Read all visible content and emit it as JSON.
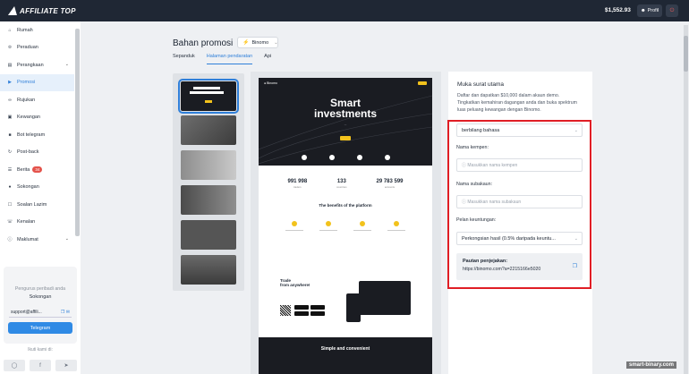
{
  "header": {
    "logo": "AFFILIATE TOP",
    "balance": "$1,552.93",
    "profile_label": "Profil",
    "logout_icon": "logout-icon"
  },
  "sidebar": {
    "items": [
      {
        "label": "Rumah",
        "icon": "home-icon"
      },
      {
        "label": "Peraduan",
        "icon": "trophy-icon"
      },
      {
        "label": "Perangkaan",
        "icon": "chart-icon"
      },
      {
        "label": "Promosi",
        "icon": "megaphone-icon"
      },
      {
        "label": "Rujukan",
        "icon": "link-icon"
      },
      {
        "label": "Kewangan",
        "icon": "wallet-icon"
      },
      {
        "label": "Bot telegram",
        "icon": "bot-icon"
      },
      {
        "label": "Post-back",
        "icon": "postback-icon"
      },
      {
        "label": "Berita",
        "icon": "news-icon",
        "badge": "34"
      },
      {
        "label": "Sokongan",
        "icon": "support-icon"
      },
      {
        "label": "Soalan Lazim",
        "icon": "faq-icon"
      },
      {
        "label": "Kenalan",
        "icon": "contacts-icon"
      },
      {
        "label": "Maklumat",
        "icon": "info-icon"
      }
    ],
    "support": {
      "title": "Pengurus peribadi anda",
      "name": "Sokongan",
      "email": "support@affili...",
      "telegram_button": "Telegram"
    },
    "follow_label": "Ikuti kami di:"
  },
  "main": {
    "title": "Bahan promosi",
    "brand_selector": "Binomo",
    "tabs": [
      "Sepanduk",
      "Halaman pendaratan",
      "Api"
    ],
    "active_tab": "Halaman pendaratan"
  },
  "landing_preview": {
    "hero_title_line1": "Smart",
    "hero_title_line2": "investments",
    "stats": [
      {
        "value": "991 998",
        "label": "traders"
      },
      {
        "value": "133",
        "label": "countries"
      },
      {
        "value": "29 783 599",
        "label": "accounts"
      }
    ],
    "benefits_title": "The benefits of the platform",
    "trade_title_line1": "Trade",
    "trade_title_line2": "from anywhere!",
    "footer_title": "Simple and convenient"
  },
  "form": {
    "title": "Muka surat utama",
    "description": "Daftar dan dapatkan $10,000 dalam akaun demo. Tingkatkan kemahiran dagangan anda dan buka spektrum luas peluang kewangan dengan Binomo.",
    "language_value": "berbilang bahasa",
    "campaign_label": "Nama kempen:",
    "campaign_placeholder": "Masukkan nama kempen",
    "subaccount_label": "Nama subakaun:",
    "subaccount_placeholder": "Masukkan nama subakaun",
    "profit_label": "Pelan keuntungan:",
    "profit_value": "Perkongsian hasil (0.5% daripada keuntu...",
    "link_title": "Pautan penjejakan:",
    "link_url": "https://binomo.com?a=2215166e5020"
  },
  "watermark": "smart-binary.com",
  "colors": {
    "accent": "#2f7fd9",
    "topbar": "#1f2734",
    "highlight": "#e01e25"
  }
}
